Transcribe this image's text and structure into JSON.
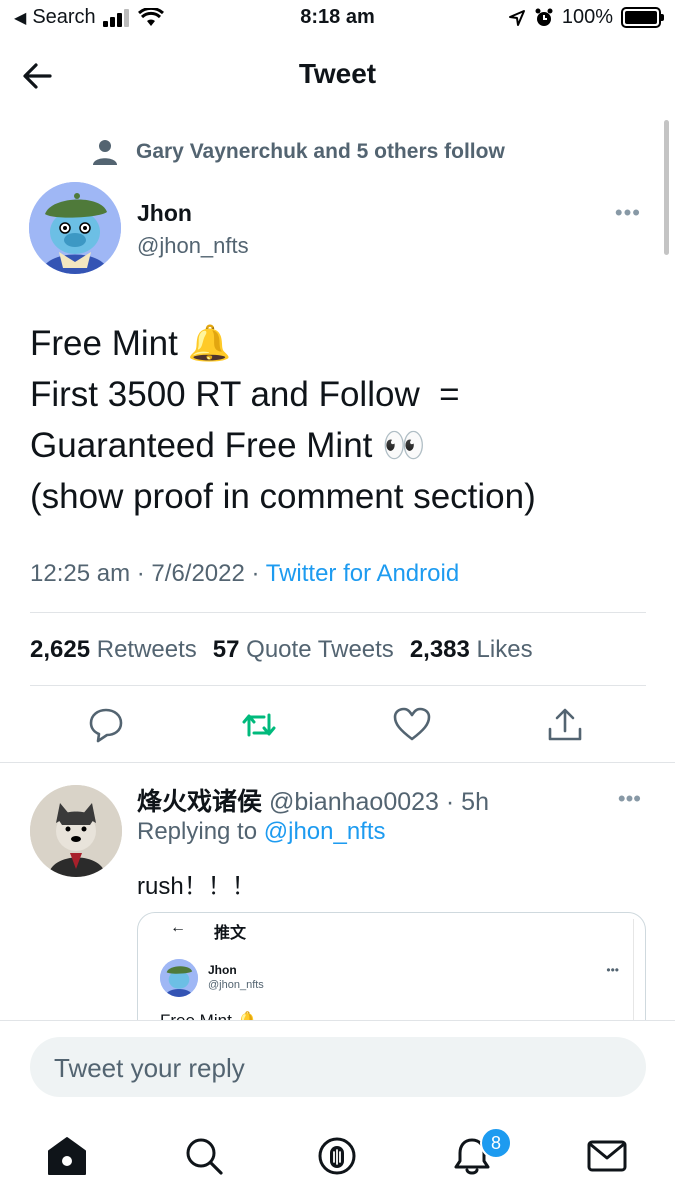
{
  "status_bar": {
    "back_app": "Search",
    "time": "8:18 am",
    "battery": "100%"
  },
  "header": {
    "title": "Tweet"
  },
  "tweet": {
    "social_context": "Gary Vaynerchuk and 5 others follow",
    "author_name": "Jhon",
    "author_handle": "@jhon_nfts",
    "text_lines": [
      "Free Mint 🔔",
      "First 3500 RT and Follow  =",
      "Guaranteed Free Mint 👀",
      "(show proof in comment section)"
    ],
    "time": "12:25 am",
    "date": "7/6/2022",
    "source": "Twitter for Android",
    "stats": {
      "retweets": "2,625",
      "retweets_label": "Retweets",
      "quotes": "57",
      "quotes_label": "Quote Tweets",
      "likes": "2,383",
      "likes_label": "Likes"
    }
  },
  "reply": {
    "name": "烽火戏诸侯",
    "handle": "@bianhao0023",
    "age": "5h",
    "replying_label": "Replying to",
    "replying_to": "@jhon_nfts",
    "text": "rush！！！",
    "media": {
      "title": "推文",
      "name": "Jhon",
      "handle": "@jhon_nfts",
      "text": "Free Mint 🔔"
    }
  },
  "compose": {
    "placeholder": "Tweet your reply"
  },
  "tabbar": {
    "notifications_badge": "8"
  },
  "colors": {
    "accent": "#1d9bf0",
    "retweet_green": "#00ba7c",
    "muted": "#536471"
  }
}
